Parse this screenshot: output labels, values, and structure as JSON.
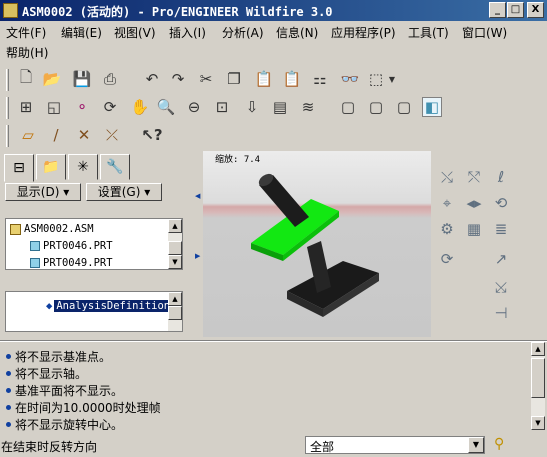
{
  "window": {
    "title": "ASM0002 (活动的) - Pro/ENGINEER Wildfire 3.0",
    "minimize_glyph": "_",
    "maximize_glyph": "□",
    "close_glyph": "X"
  },
  "menu": {
    "items": [
      "文件(F)",
      "编辑(E)",
      "视图(V)",
      "插入(I)",
      "分析(A)",
      "信息(N)",
      "应用程序(P)",
      "工具(T)",
      "窗口(W)",
      "帮助(H)"
    ]
  },
  "toolbar": {
    "row1_icons": [
      "new-file-icon",
      "open-folder-icon",
      "save-icon",
      "print-icon",
      "undo-icon",
      "redo-icon",
      "cut-icon",
      "copy-icon",
      "paste-icon",
      "paste-special-icon",
      "regenerate-icon",
      "find-binoculars-icon",
      "select-box-icon"
    ],
    "row2_icons": [
      "model-tree-icon",
      "repaint-icon",
      "spin-center-icon",
      "orient-icon",
      "pan-hand-icon",
      "zoom-in-icon",
      "zoom-out-icon",
      "refit-icon",
      "reorient-icon",
      "saved-views-icon",
      "layers-icon",
      "wireframe-icon",
      "hidden-line-icon",
      "no-hidden-icon",
      "shading-icon"
    ],
    "row3_icons": [
      "datum-plane-display-icon",
      "datum-axis-display-icon",
      "point-display-icon",
      "csys-display-icon",
      "context-help-icon"
    ]
  },
  "left_panel": {
    "display_label": "显示(D)",
    "settings_label": "设置(G)",
    "tree_items": [
      "ASM0002.ASM",
      "PRT0046.PRT",
      "PRT0049.PRT"
    ],
    "lower_tree_item": "AnalysisDefinition"
  },
  "viewport": {
    "zoom_label": "缩放: 7.4",
    "colors": {
      "background_top": "#e0e0e0",
      "background_band": "#d0a8a8",
      "background_bottom": "#c8c8c8",
      "highlight_part": "#10e010",
      "dark_part": "#1e1e1e"
    }
  },
  "right_toolbar": {
    "icons": [
      "motor-icon",
      "servo-icon",
      "spring-icon",
      "damper-icon",
      "force-icon",
      "gravity-icon",
      "gear-icon",
      "joint-icon",
      "connection-icon",
      "mechanism-run-icon",
      "analysis-icon",
      "playback-icon",
      "measure-icon",
      "drag-icon",
      "snapshot-icon"
    ]
  },
  "messages": [
    "将不显示基准点。",
    "将不显示轴。",
    "基准平面将不显示。",
    "在时间为10.0000时处理帧",
    "将不显示旋转中心。"
  ],
  "status": {
    "hint_text": "在结束时反转方向",
    "filter_value": "全部"
  }
}
